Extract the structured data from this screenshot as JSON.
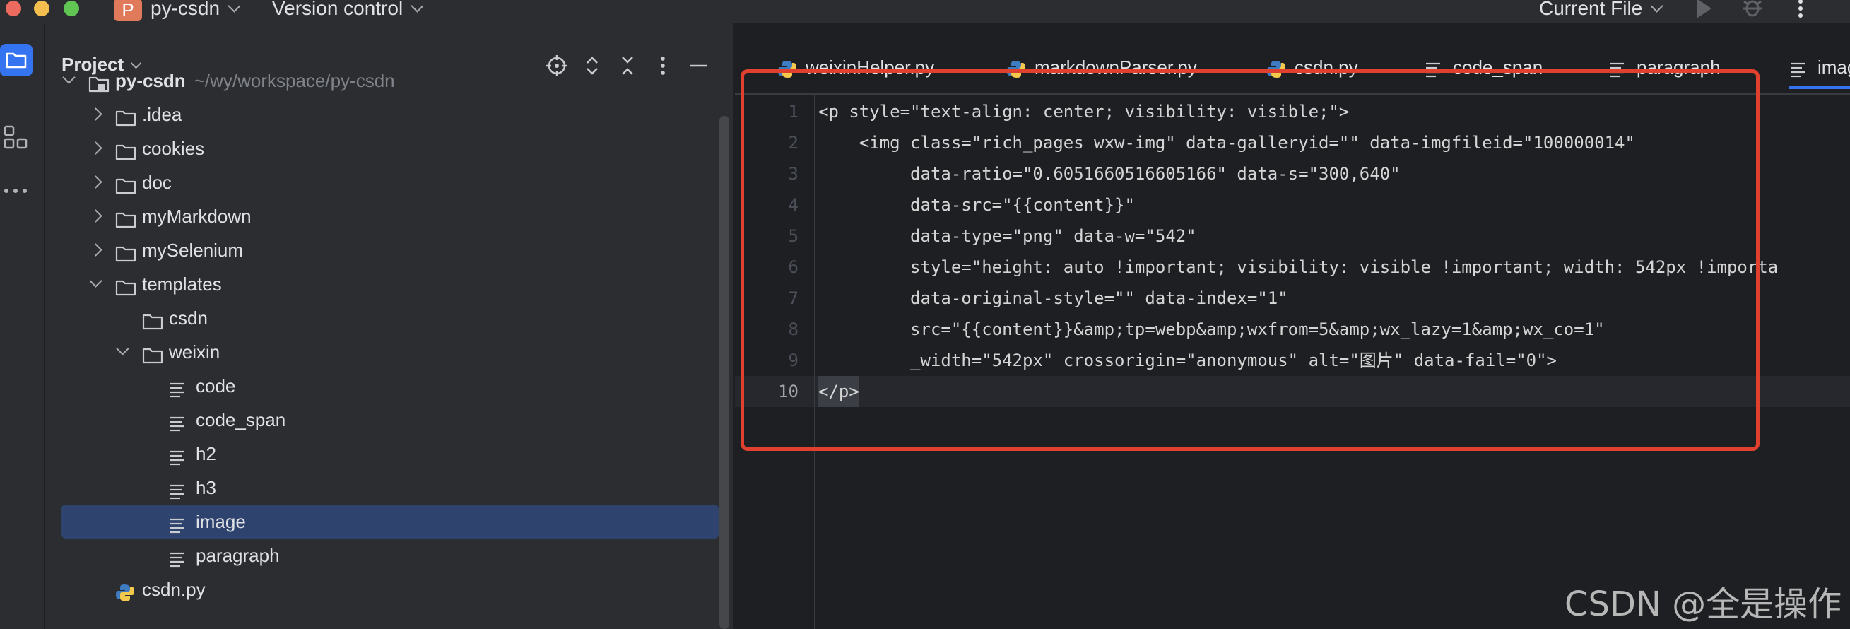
{
  "titlebar": {
    "project_badge": "P",
    "project_name": "py-csdn",
    "version_control": "Version control",
    "run_config": "Current File"
  },
  "project_panel": {
    "title": "Project",
    "tree": [
      {
        "label": "py-csdn",
        "path": "~/wy/workspace/py-csdn",
        "icon": "folder-module-icon",
        "expanded": true,
        "bold": true
      },
      {
        "label": ".idea",
        "icon": "folder-icon",
        "expanded": false
      },
      {
        "label": "cookies",
        "icon": "folder-icon",
        "expanded": false
      },
      {
        "label": "doc",
        "icon": "folder-icon",
        "expanded": false
      },
      {
        "label": "myMarkdown",
        "icon": "folder-icon",
        "expanded": false
      },
      {
        "label": "mySelenium",
        "icon": "folder-icon",
        "expanded": false
      },
      {
        "label": "templates",
        "icon": "folder-icon",
        "expanded": true
      },
      {
        "label": "csdn",
        "icon": "folder-icon"
      },
      {
        "label": "weixin",
        "icon": "folder-icon",
        "expanded": true
      },
      {
        "label": "code",
        "icon": "text-file-icon"
      },
      {
        "label": "code_span",
        "icon": "text-file-icon"
      },
      {
        "label": "h2",
        "icon": "text-file-icon"
      },
      {
        "label": "h3",
        "icon": "text-file-icon"
      },
      {
        "label": "image",
        "icon": "text-file-icon",
        "selected": true
      },
      {
        "label": "paragraph",
        "icon": "text-file-icon"
      },
      {
        "label": "csdn.py",
        "icon": "python-file-icon"
      }
    ]
  },
  "editor": {
    "tabs": [
      {
        "label": "weixinHelper.py",
        "icon": "python-file-icon"
      },
      {
        "label": "markdownParser.py",
        "icon": "python-file-icon"
      },
      {
        "label": "csdn.py",
        "icon": "python-file-icon"
      },
      {
        "label": "code_span",
        "icon": "text-file-icon"
      },
      {
        "label": "paragraph",
        "icon": "text-file-icon"
      },
      {
        "label": "imag",
        "icon": "text-file-icon",
        "active": true
      }
    ],
    "lines": [
      {
        "n": "1",
        "text": "<p style=\"text-align: center; visibility: visible;\">"
      },
      {
        "n": "2",
        "text": "    <img class=\"rich_pages wxw-img\" data-galleryid=\"\" data-imgfileid=\"100000014\""
      },
      {
        "n": "3",
        "text": "         data-ratio=\"0.6051660516605166\" data-s=\"300,640\""
      },
      {
        "n": "4",
        "text": "         data-src=\"{{content}}\""
      },
      {
        "n": "5",
        "text": "         data-type=\"png\" data-w=\"542\""
      },
      {
        "n": "6",
        "text": "         style=\"height: auto !important; visibility: visible !important; width: 542px !importa"
      },
      {
        "n": "7",
        "text": "         data-original-style=\"\" data-index=\"1\""
      },
      {
        "n": "8",
        "text": "         src=\"{{content}}&amp;tp=webp&amp;wxfrom=5&amp;wx_lazy=1&amp;wx_co=1\""
      },
      {
        "n": "9",
        "text": "         _width=\"542px\" crossorigin=\"anonymous\" alt=\"图片\" data-fail=\"0\">"
      },
      {
        "n": "10",
        "text": "</p>",
        "current": true
      }
    ]
  },
  "watermark": "CSDN @全是操作",
  "colors": {
    "accent": "#3574f0",
    "selection": "#2e436e",
    "highlight_box": "#e0402e"
  }
}
